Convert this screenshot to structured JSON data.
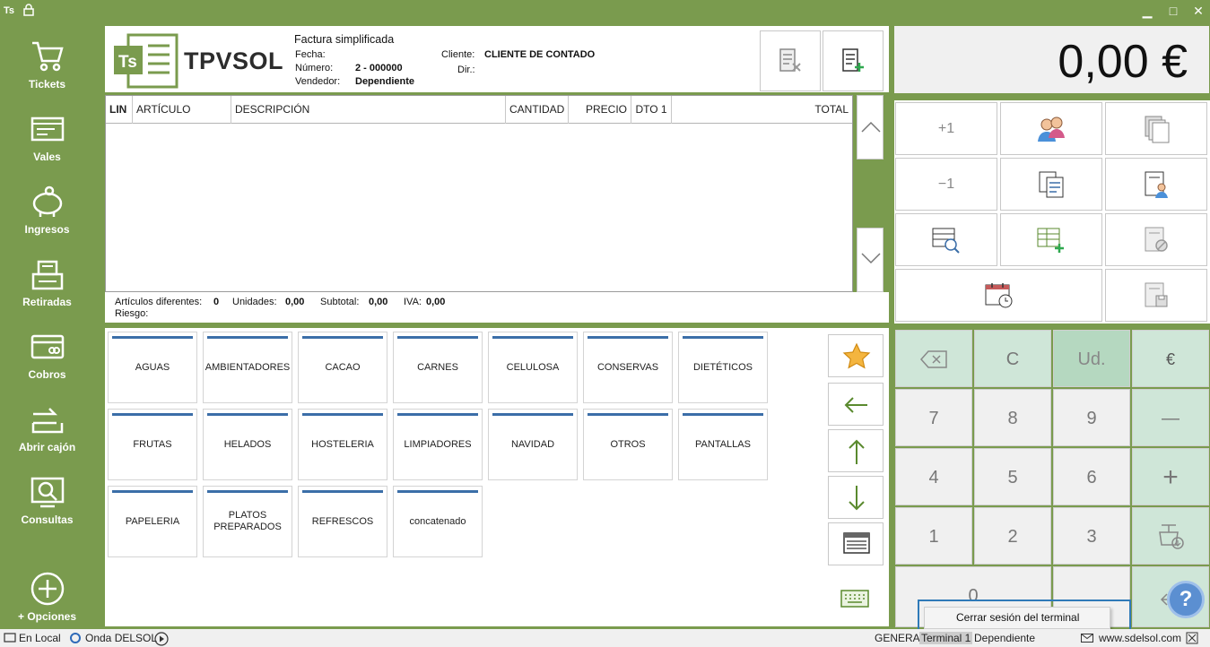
{
  "titlebar": {
    "app_badge": "Ts",
    "minimize": "▁",
    "maximize": "□",
    "close": "✕"
  },
  "sidebar": {
    "items": [
      {
        "label": "Tickets"
      },
      {
        "label": "Vales"
      },
      {
        "label": "Ingresos"
      },
      {
        "label": "Retiradas"
      },
      {
        "label": "Cobros"
      },
      {
        "label": "Abrir cajón"
      },
      {
        "label": "Consultas"
      },
      {
        "label": "+ Opciones"
      }
    ]
  },
  "header": {
    "logo_text": "TPVSOL",
    "logo_badge": "Ts",
    "doc_type": "Factura simplificada",
    "fecha_label": "Fecha:",
    "numero_label": "Número:",
    "numero_value": "2 - 000000",
    "vendedor_label": "Vendedor:",
    "vendedor_value": "Dependiente",
    "cliente_label": "Cliente:",
    "cliente_value": "CLIENTE DE CONTADO",
    "dir_label": "Dir.:"
  },
  "grid": {
    "columns": [
      "LIN",
      "ARTÍCULO",
      "DESCRIPCIÓN",
      "CANTIDAD",
      "PRECIO",
      "DTO 1",
      "TOTAL"
    ]
  },
  "totals": {
    "articulos_label": "Artículos diferentes:",
    "articulos_value": "0",
    "unidades_label": "Unidades:",
    "unidades_value": "0,00",
    "subtotal_label": "Subtotal:",
    "subtotal_value": "0,00",
    "iva_label": "IVA:",
    "iva_value": "0,00",
    "riesgo_label": "Riesgo:"
  },
  "families": [
    "AGUAS",
    "AMBIENTADORES",
    "CACAO",
    "CARNES",
    "CELULOSA",
    "CONSERVAS",
    "DIETÉTICOS",
    "FRUTAS",
    "HELADOS",
    "HOSTELERIA",
    "LIMPIADORES",
    "NAVIDAD",
    "OTROS",
    "PANTALLAS",
    "PAPELERIA",
    "PLATOS PREPARADOS",
    "REFRESCOS",
    "concatenado"
  ],
  "display": {
    "amount": "0,00 €"
  },
  "actions": {
    "plus_one": "+1",
    "minus_one": "−1"
  },
  "keypad": {
    "clear": "C",
    "units": "Ud.",
    "euro": "€",
    "minus": "—",
    "plus": "+",
    "k7": "7",
    "k8": "8",
    "k9": "9",
    "k4": "4",
    "k5": "5",
    "k6": "6",
    "k1": "1",
    "k2": "2",
    "k3": "3",
    "k0": "0"
  },
  "context_menu": {
    "item": "Cerrar sesión del terminal"
  },
  "help": {
    "label": "?"
  },
  "statusbar": {
    "local": "En Local",
    "onda": "Onda DELSOL",
    "general": "GENERAL",
    "terminal": "Terminal 1",
    "user": "Dependiente",
    "web": "www.sdelsol.com"
  },
  "colors": {
    "brand_green": "#7a9b4e",
    "family_accent": "#3b6ea8",
    "keypad_green": "#cfe6d8"
  }
}
